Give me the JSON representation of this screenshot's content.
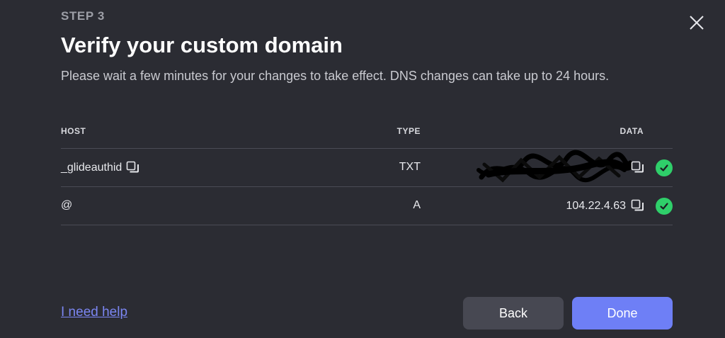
{
  "header": {
    "step": "STEP 3",
    "title": "Verify your custom domain",
    "subtitle": "Please wait a few minutes for your changes to take effect. DNS changes can take up to 24 hours."
  },
  "table": {
    "columns": {
      "host": "HOST",
      "type": "TYPE",
      "data": "DATA"
    },
    "rows": [
      {
        "host": "_glideauthid",
        "type": "TXT",
        "data": "",
        "data_redacted": true,
        "verified": true
      },
      {
        "host": "@",
        "type": "A",
        "data": "104.22.4.63",
        "verified": true
      }
    ]
  },
  "footer": {
    "help_link": "I need help",
    "back_label": "Back",
    "done_label": "Done"
  },
  "colors": {
    "background": "#2b2c33",
    "accent": "#6e7ff6",
    "success": "#2fcf6a",
    "link": "#7b86f2"
  },
  "icons": [
    "close-icon",
    "copy-icon",
    "check-circle-icon"
  ]
}
